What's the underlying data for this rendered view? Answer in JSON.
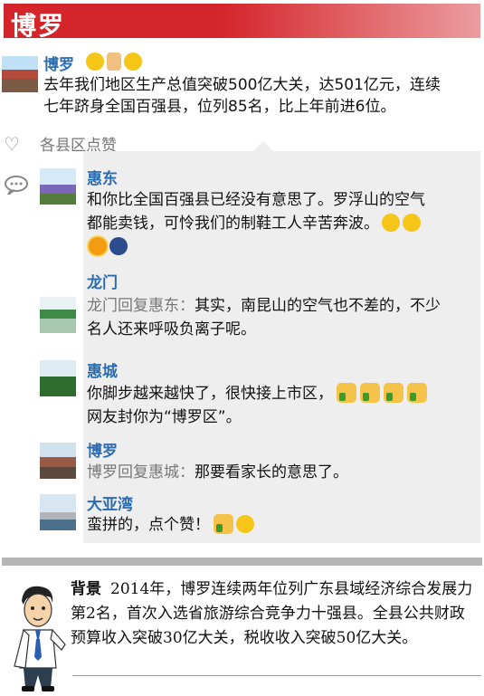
{
  "header": {
    "title": "博罗"
  },
  "post": {
    "author": "博罗",
    "text_line1": "去年我们地区生产总值突破500亿大关，达501亿元，连续",
    "text_line2": "七年跻身全国百强县，位列85名，比上年前进6位。"
  },
  "likes": {
    "label": "各县区点赞"
  },
  "comments": [
    {
      "name": "惠东",
      "line1": "和你比全国百强县已经没有意思了。罗浮山的空气",
      "line2": "都能卖钱，可怜我们的制鞋工人辛苦奔波。"
    },
    {
      "name": "龙门",
      "reply_prefix": "龙门回复惠东：",
      "line1": "其实，南昆山的空气也不差的，不少",
      "line2": "名人还来呼吸负离子呢。"
    },
    {
      "name": "惠城",
      "line1": "你脚步越来越快了，很快接上市区，",
      "line2": "网友封你为“博罗区”。"
    },
    {
      "name": "博罗",
      "reply_prefix": "博罗回复惠城：",
      "line1": "那要看家长的意思了。"
    },
    {
      "name": "大亚湾",
      "line1": "蛮拼的，点个赞！"
    }
  ],
  "background": {
    "label": "背景",
    "text": "2014年，博罗连续两年位列广东县域经济综合发展力第2名，首次入选省旅游综合竞争力十强县。全县公共财政预算收入突破30亿大关，税收收入突破50亿大关。"
  },
  "icons": {
    "like": "heart-icon",
    "comment": "comment-bubble-icon",
    "thumbs": "thumbs-up-icon"
  },
  "colors": {
    "header_red": "#d4252b",
    "name_blue": "#2b6cb0",
    "panel_gray": "#eeeeee"
  }
}
